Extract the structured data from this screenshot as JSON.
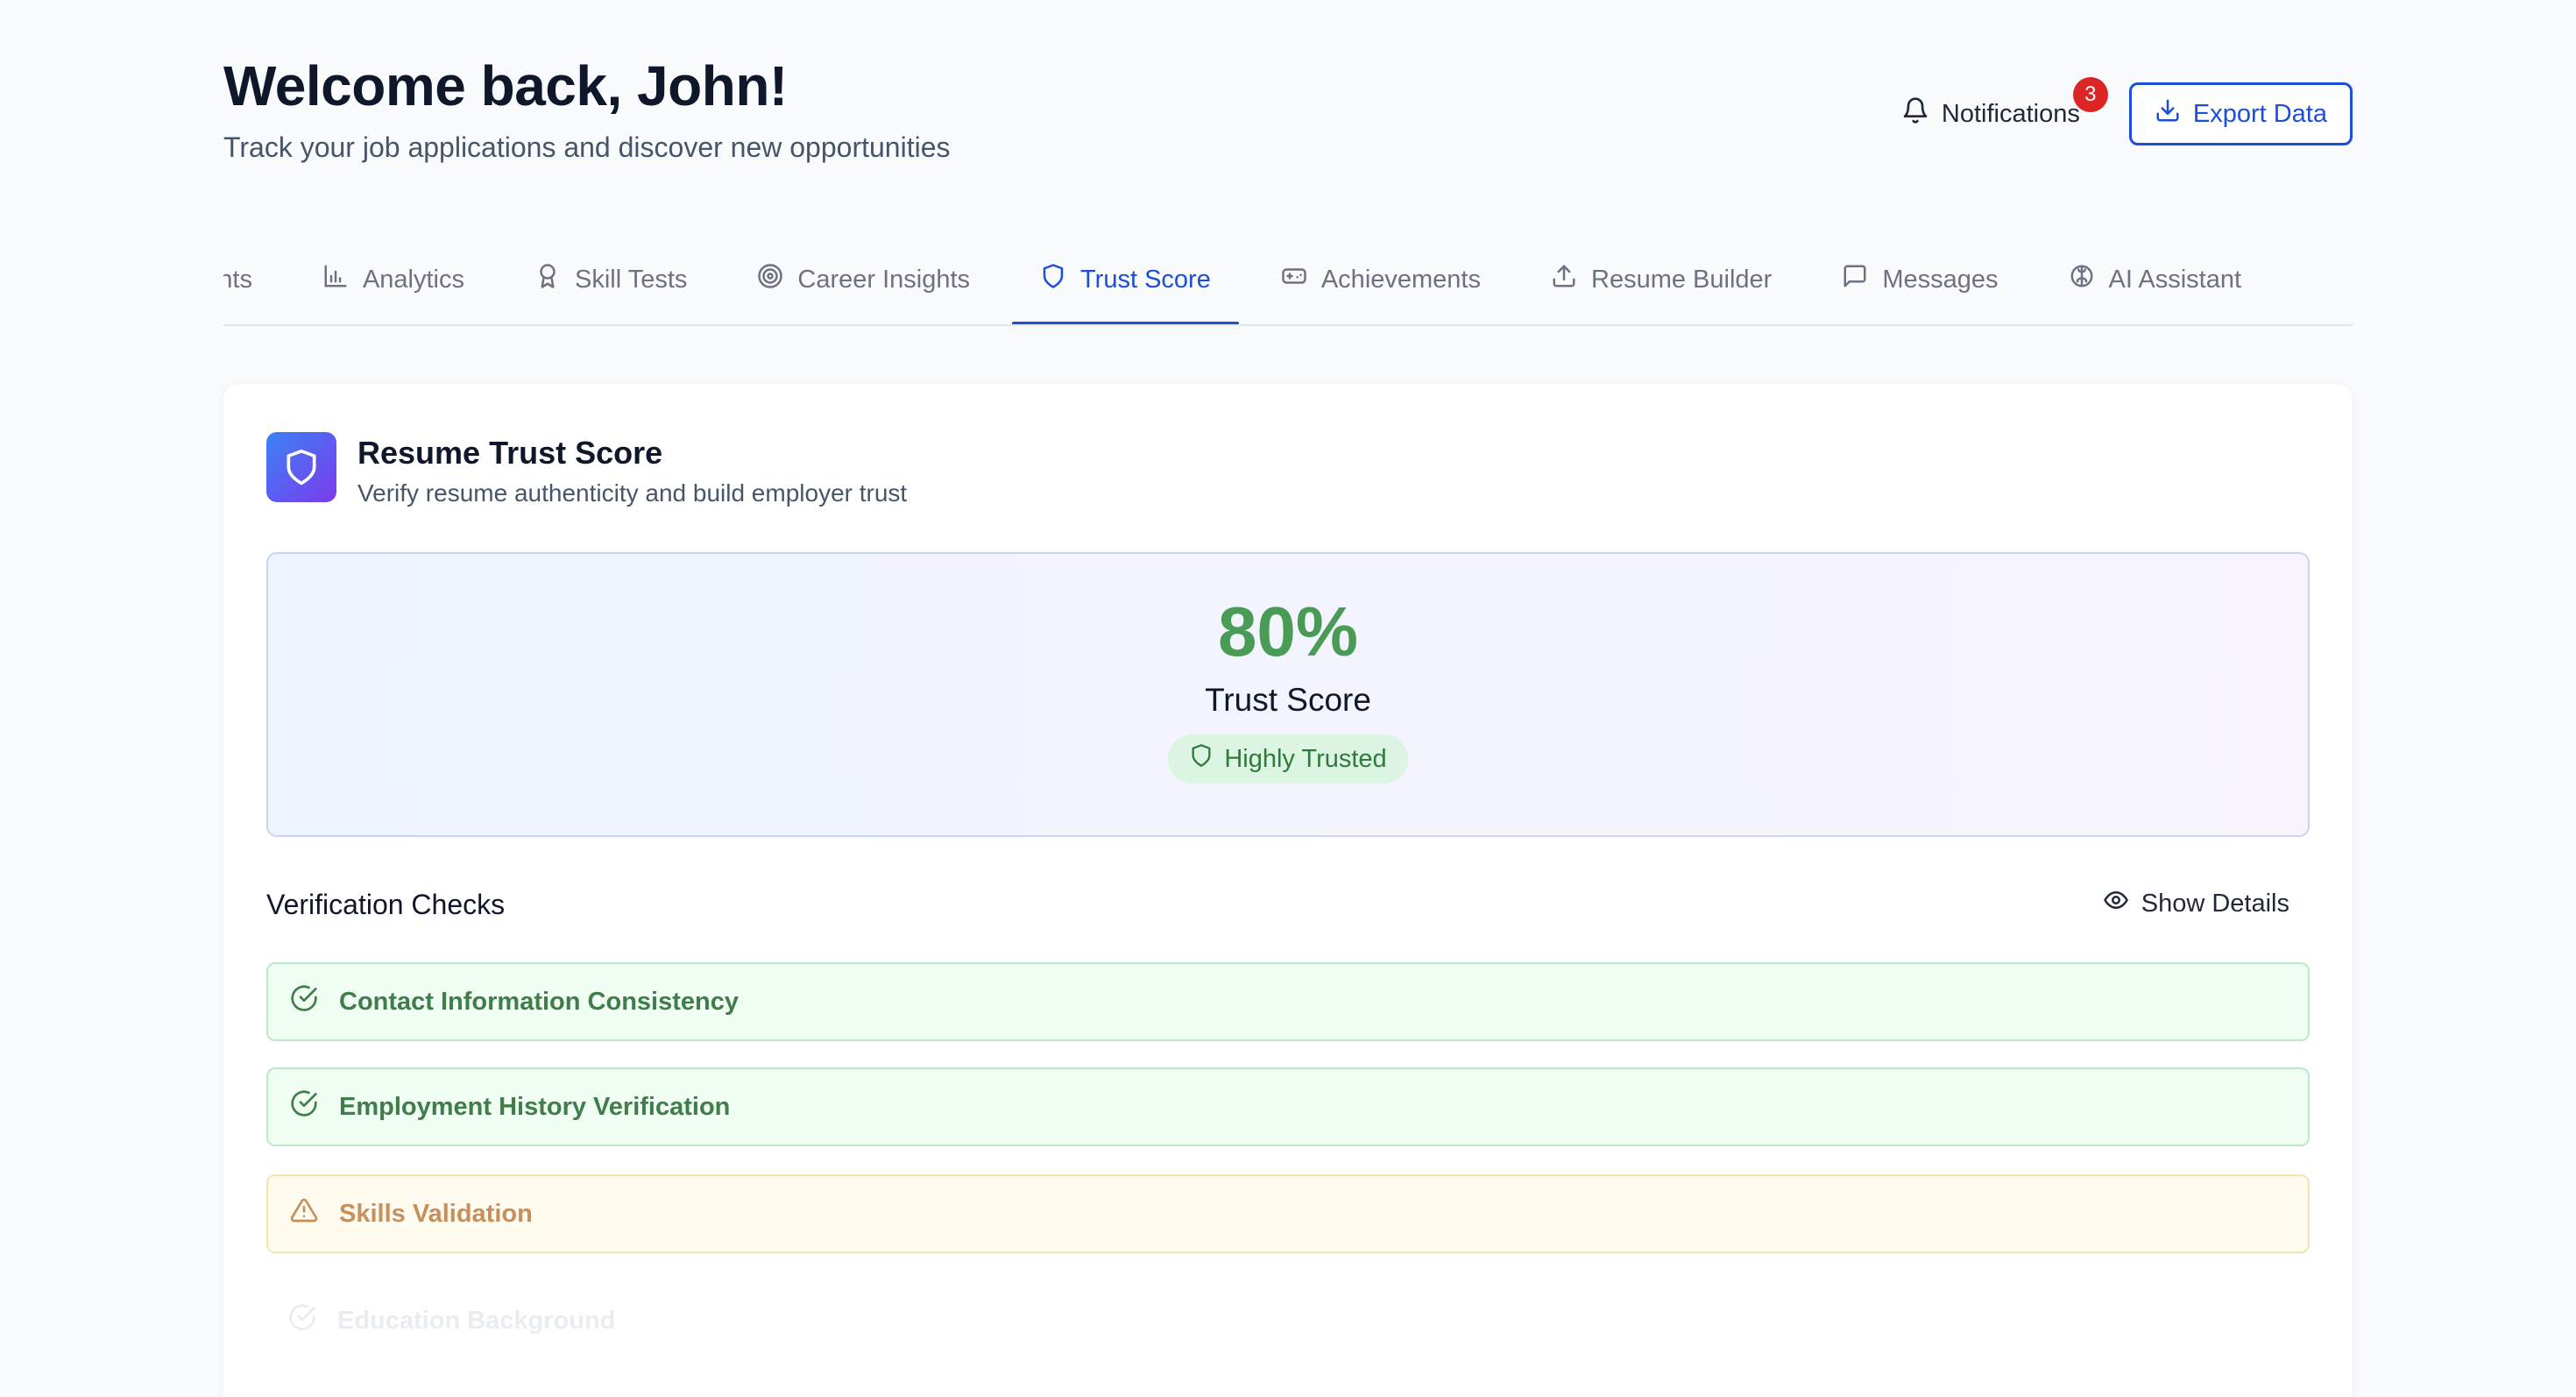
{
  "header": {
    "title": "Welcome back, John!",
    "subtitle": "Track your job applications and discover new opportunities",
    "notifications_label": "Notifications",
    "notifications_count": "3",
    "export_label": "Export Data"
  },
  "tabs": [
    {
      "label": "nents",
      "icon": "partial-tab"
    },
    {
      "label": "Analytics",
      "icon": "bar-chart-icon"
    },
    {
      "label": "Skill Tests",
      "icon": "award-icon"
    },
    {
      "label": "Career Insights",
      "icon": "target-icon"
    },
    {
      "label": "Trust Score",
      "icon": "shield-icon",
      "active": true
    },
    {
      "label": "Achievements",
      "icon": "gamepad-icon"
    },
    {
      "label": "Resume Builder",
      "icon": "upload-icon"
    },
    {
      "label": "Messages",
      "icon": "message-icon"
    },
    {
      "label": "AI Assistant",
      "icon": "brain-icon"
    }
  ],
  "card": {
    "title": "Resume Trust Score",
    "subtitle": "Verify resume authenticity and build employer trust",
    "score_value": "80%",
    "score_label": "Trust Score",
    "trust_level": "Highly Trusted",
    "checks_title": "Verification Checks",
    "show_details_label": "Show Details",
    "checks": [
      {
        "label": "Contact Information Consistency",
        "status": "passed"
      },
      {
        "label": "Employment History Verification",
        "status": "passed"
      },
      {
        "label": "Skills Validation",
        "status": "warning"
      },
      {
        "label": "Education Background",
        "status": "passed"
      }
    ]
  },
  "colors": {
    "accent": "#1d4ed8",
    "score_green": "#4a9b55",
    "badge_red": "#dc2626",
    "warn": "#c78f5c"
  }
}
